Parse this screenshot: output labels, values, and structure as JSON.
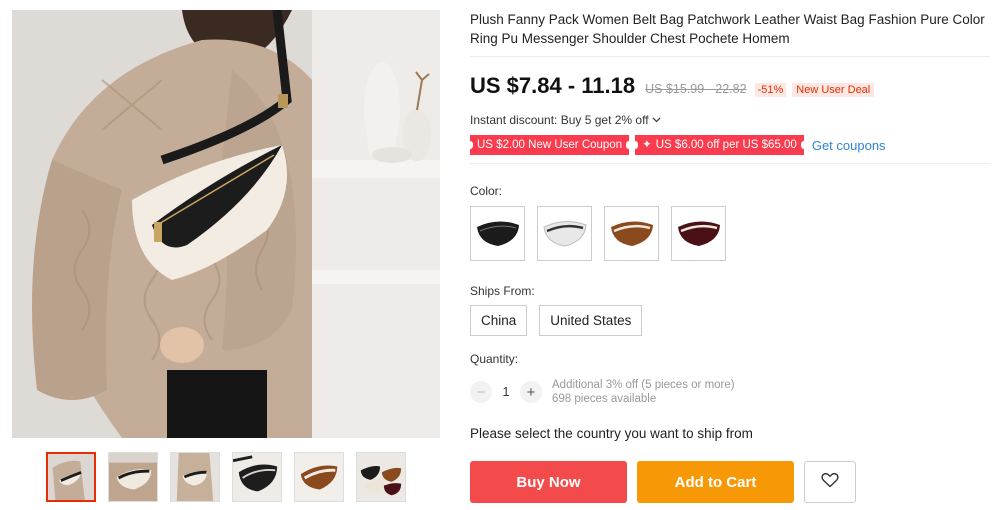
{
  "product": {
    "title": "Plush Fanny Pack Women Belt Bag Patchwork Leather Waist Bag Fashion Pure Color Ring Pu Messenger Shoulder Chest Pochete Homem",
    "price": "US $7.84 - 11.18",
    "original_price": "US $15.99 - 22.82",
    "discount": "-51%",
    "deal_badge": "New User Deal"
  },
  "promo": {
    "instant_discount": "Instant discount: Buy 5 get 2% off",
    "coupons": [
      "US $2.00 New User Coupon",
      "US $6.00 off per US $65.00"
    ],
    "get_coupons": "Get coupons"
  },
  "options": {
    "color_label": "Color:",
    "colors": [
      {
        "name": "black-bag",
        "fill": "#1b1b1b"
      },
      {
        "name": "white-bag",
        "fill": "#ececec"
      },
      {
        "name": "brown-bag",
        "fill": "#8a4a1e"
      },
      {
        "name": "wine-bag",
        "fill": "#4a1016"
      }
    ],
    "ships_label": "Ships From:",
    "ships": [
      "China",
      "United States"
    ]
  },
  "quantity": {
    "label": "Quantity:",
    "value": "1",
    "minus": "−",
    "plus": "+",
    "extra_discount": "Additional 3% off (5 pieces or more)",
    "available": "698 pieces available"
  },
  "shipping_message": "Please select the country you want to ship from",
  "actions": {
    "buy_now": "Buy Now",
    "add_to_cart": "Add to Cart"
  },
  "icons": {
    "dropdown": "chevron-down-icon",
    "coupon_star": "star-icon",
    "wishlist": "heart-icon"
  },
  "colors": {
    "price_red": "#e62e04",
    "coupon_red": "#fb3c4f",
    "link_blue": "#2f84d6",
    "buy_red": "#f34b4b",
    "cart_orange": "#f79907"
  }
}
